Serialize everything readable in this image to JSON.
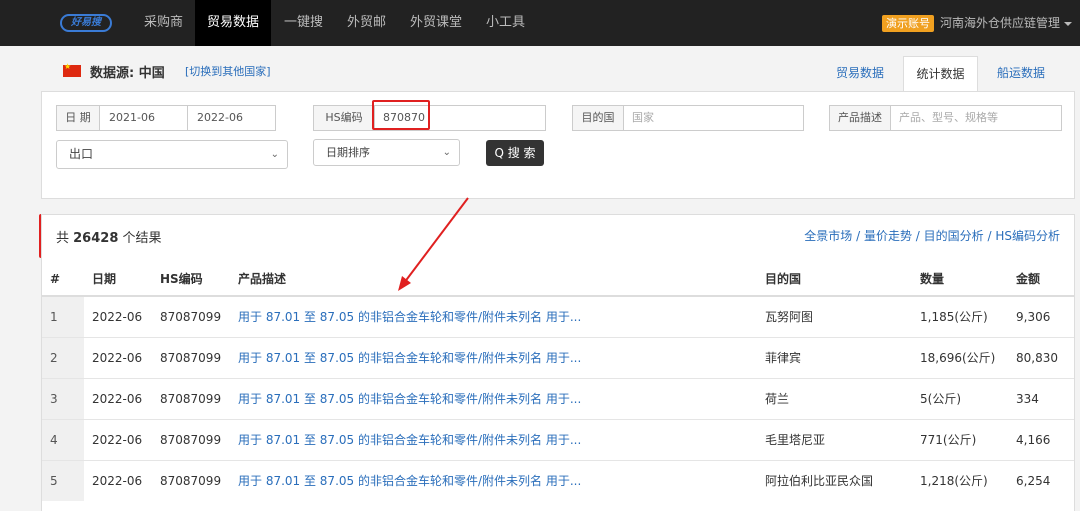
{
  "nav": {
    "logo": "好易搜",
    "items": [
      "采购商",
      "贸易数据",
      "一键搜",
      "外贸邮",
      "外贸课堂",
      "小工具"
    ],
    "active_index": 1,
    "demo_badge": "演示账号",
    "company": "河南海外仓供应链管理"
  },
  "header": {
    "source_label": "数据源: 中国",
    "switch_link": "[切换到其他国家]",
    "tabs": [
      "贸易数据",
      "统计数据",
      "船运数据"
    ],
    "active_tab": 1
  },
  "filters": {
    "date_label": "日 期",
    "date_from": "2021-06",
    "date_to": "2022-06",
    "hs_label": "HS编码",
    "hs_value": "870870",
    "dest_label": "目的国",
    "dest_placeholder": "国家",
    "product_label": "产品描述",
    "product_placeholder": "产品、型号、规格等",
    "direction": "出口",
    "sort": "日期排序",
    "search_button": "Q 搜 索"
  },
  "results": {
    "count_prefix": "共 ",
    "count": "26428",
    "count_suffix": " 个结果",
    "analysis_links": [
      "全景市场",
      "量价走势",
      "目的国分析",
      "HS编码分析"
    ],
    "columns": [
      "#",
      "日期",
      "HS编码",
      "产品描述",
      "目的国",
      "数量",
      "金额"
    ],
    "rows": [
      {
        "n": "1",
        "date": "2022-06",
        "hs": "87087099",
        "desc": "用于 87.01 至 87.05 的非铝合金车轮和零件/附件未列名 用于...",
        "dest": "瓦努阿图",
        "qty": "1,185(公斤)",
        "amount": "9,306"
      },
      {
        "n": "2",
        "date": "2022-06",
        "hs": "87087099",
        "desc": "用于 87.01 至 87.05 的非铝合金车轮和零件/附件未列名 用于...",
        "dest": "菲律宾",
        "qty": "18,696(公斤)",
        "amount": "80,830"
      },
      {
        "n": "3",
        "date": "2022-06",
        "hs": "87087099",
        "desc": "用于 87.01 至 87.05 的非铝合金车轮和零件/附件未列名 用于...",
        "dest": "荷兰",
        "qty": "5(公斤)",
        "amount": "334"
      },
      {
        "n": "4",
        "date": "2022-06",
        "hs": "87087099",
        "desc": "用于 87.01 至 87.05 的非铝合金车轮和零件/附件未列名 用于...",
        "dest": "毛里塔尼亚",
        "qty": "771(公斤)",
        "amount": "4,166"
      },
      {
        "n": "5",
        "date": "2022-06",
        "hs": "87087099",
        "desc": "用于 87.01 至 87.05 的非铝合金车轮和零件/附件未列名 用于...",
        "dest": "阿拉伯利比亚民众国",
        "qty": "1,218(公斤)",
        "amount": "6,254"
      }
    ]
  },
  "colors": {
    "nav_bg": "#222222",
    "link": "#2a6ebb",
    "highlight": "#e02020",
    "badge": "#f0a020"
  }
}
